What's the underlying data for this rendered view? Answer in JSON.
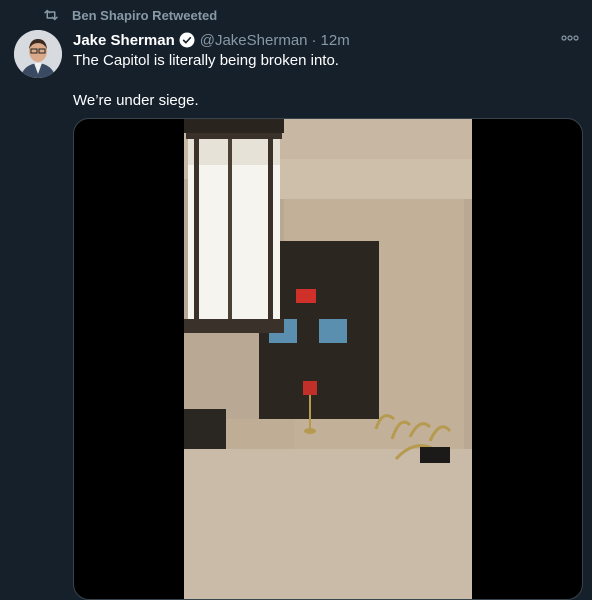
{
  "retweet": {
    "text": "Ben Shapiro Retweeted",
    "icon": "retweet-icon"
  },
  "tweet": {
    "display_name": "Jake Sherman",
    "handle": "@JakeSherman",
    "separator": "·",
    "time": "12m",
    "verified": true,
    "text_lines": [
      "The Capitol is literally being broken into.",
      "We’re under siege."
    ]
  },
  "colors": {
    "background": "#15202b",
    "secondary_text": "#8899a6",
    "verified_badge": "#ffffff",
    "media_border": "#38444d"
  }
}
